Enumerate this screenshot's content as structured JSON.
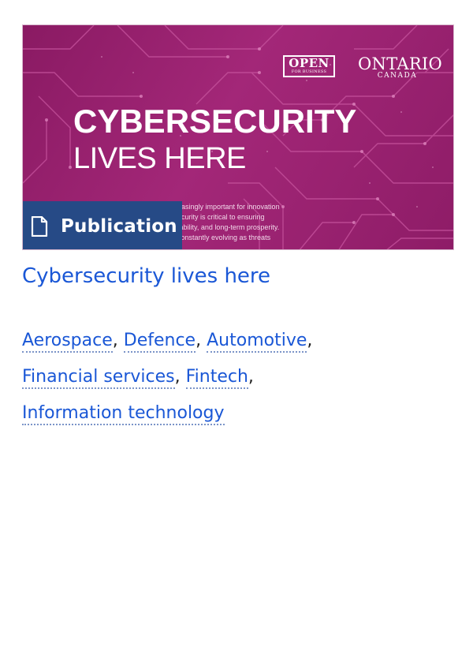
{
  "card": {
    "hero": {
      "open_logo": {
        "big": "OPEN",
        "small": "FOR BUSINESS"
      },
      "ontario_logo": {
        "big": "ONTARIO",
        "small": "CANADA"
      },
      "headline": "CYBERSECURITY",
      "subheadline": "LIVES HERE",
      "body_lines": [
        "easingly important for innovation",
        "ecurity is critical to ensuring",
        "tability, and long-term prosperity.",
        "constantly evolving as threats"
      ],
      "colors": {
        "background": "#9a2270",
        "circuit": "#c8559f"
      }
    },
    "badge": {
      "label": "Publication",
      "icon": "document-icon",
      "color": "#264a86"
    },
    "title": "Cybersecurity lives here",
    "tags": [
      {
        "label": "Aerospace",
        "sep": ", "
      },
      {
        "label": "Defence",
        "sep": ", "
      },
      {
        "label": "Automotive",
        "sep": ","
      },
      {
        "label": "Financial services",
        "sep": ", "
      },
      {
        "label": "Fintech",
        "sep": ","
      },
      {
        "label": "Information technology",
        "sep": ""
      }
    ],
    "link_color": "#1a57d6"
  }
}
